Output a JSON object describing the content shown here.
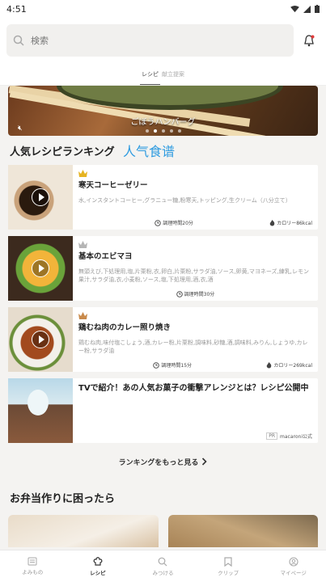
{
  "status": {
    "time": "4:51"
  },
  "search": {
    "placeholder": "検索"
  },
  "tabs": [
    {
      "label": "レシピ"
    },
    {
      "label": "献立提案"
    }
  ],
  "banner": {
    "title": "ごぼうハンバーグ",
    "dots": 5,
    "active_dot": 1
  },
  "ranking": {
    "title": "人気レシピランキング",
    "overlay_note": "人气食谱",
    "items": [
      {
        "title": "寒天コーヒーゼリー",
        "ingredients": "水,インスタントコーヒー,グラニュー糖,粉寒天,トッピング,生クリーム（八分立て）",
        "time": "調理時間20分",
        "calories": "カロリー86kcal",
        "crown_color": "#e6b422"
      },
      {
        "title": "基本のエビマヨ",
        "ingredients": "無頭えび,下処理用,塩,片栗粉,衣,卵白,片栗粉,サラダ油,ソース,卵黄,マヨネーズ,練乳,レモン果汁,サラダ油,衣,小麦粉,ソース,塩,下処理用,酒,衣,酒",
        "time": "調理時間30分",
        "calories": "",
        "crown_color": "#b5b5b5"
      },
      {
        "title": "鶏むね肉のカレー照り焼き",
        "ingredients": "鶏むね肉,味付塩こしょう,酒,カレー粉,片栗粉,調味料,砂糖,酒,調味料,みりん,しょうゆ,カレー粉,サラダ油",
        "time": "調理時間15分",
        "calories": "カロリー269kcal",
        "crown_color": "#c98a4b"
      }
    ],
    "pr": {
      "title": "TVで紹介！あの人気お菓子の衝撃アレンジとは？レシピ公開中",
      "badge": "PR",
      "sponsor": "macaroni公式"
    },
    "more_label": "ランキングをもっと見る"
  },
  "section2": {
    "title": "お弁当作りに困ったら"
  },
  "nav": [
    {
      "label": "よみもの",
      "icon": "book-icon",
      "active": false
    },
    {
      "label": "レシピ",
      "icon": "chef-hat-icon",
      "active": true
    },
    {
      "label": "みつける",
      "icon": "search-icon",
      "active": false
    },
    {
      "label": "クリップ",
      "icon": "bookmark-icon",
      "active": false
    },
    {
      "label": "マイページ",
      "icon": "user-icon",
      "active": false
    }
  ]
}
